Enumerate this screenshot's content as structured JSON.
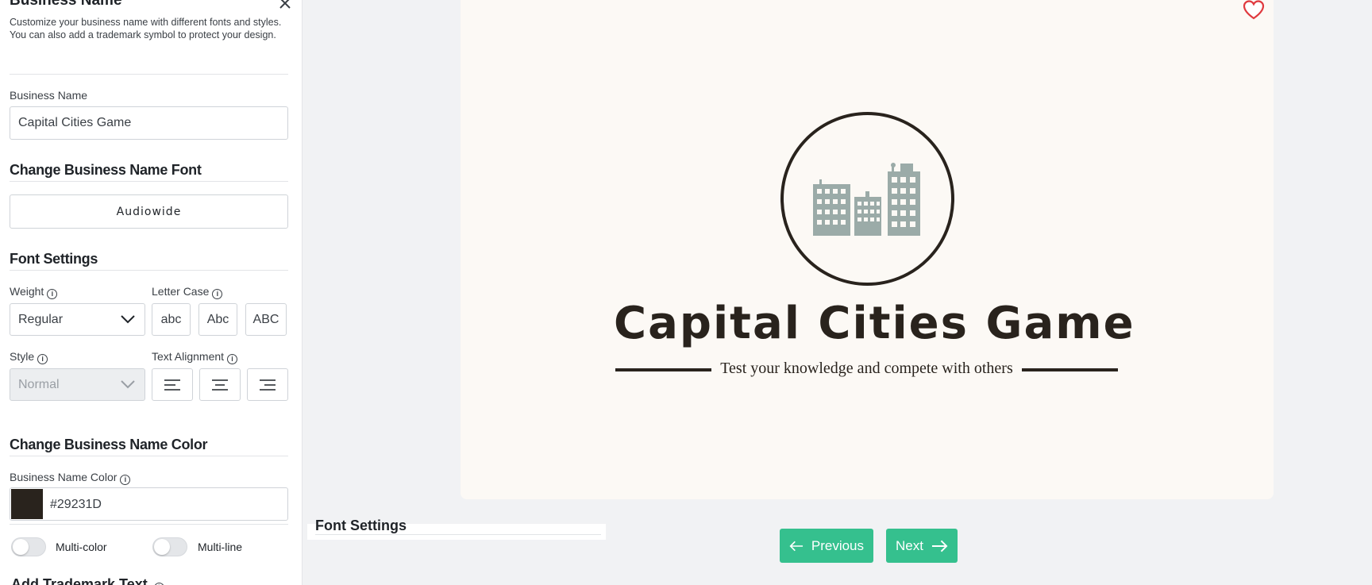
{
  "sidebar": {
    "title": "Business Name",
    "description": "Customize your business name with different fonts and styles. You can also add a trademark symbol to protect your design.",
    "business_name_label": "Business Name",
    "business_name_value": "Capital Cities Game",
    "change_font_title": "Change Business Name Font",
    "font_button_label": "Audiowide",
    "font_settings_title": "Font Settings",
    "weight_label": "Weight",
    "weight_value": "Regular",
    "letter_case_label": "Letter Case",
    "letter_case_options": [
      "abc",
      "Abc",
      "ABC"
    ],
    "style_label": "Style",
    "style_value": "Normal",
    "text_alignment_label": "Text Alignment",
    "change_color_title": "Change Business Name Color",
    "color_label": "Business Name Color",
    "color_value": "#29231D",
    "multicolor_label": "Multi-color",
    "multiline_label": "Multi-line",
    "trademark_title": "Add Trademark Text"
  },
  "ghost": {
    "title": "Font Settings"
  },
  "canvas": {
    "brand_name": "Capital Cities Game",
    "tagline": "Test your knowledge and compete with others",
    "logo_icon": "city-buildings-icon",
    "favorite_icon": "heart-icon"
  },
  "navigation": {
    "previous_label": "Previous",
    "next_label": "Next"
  },
  "colors": {
    "brand": "#29231D",
    "accent": "#35C08E",
    "canvas_bg": "#FCF9F5",
    "building": "#9BABA8"
  }
}
